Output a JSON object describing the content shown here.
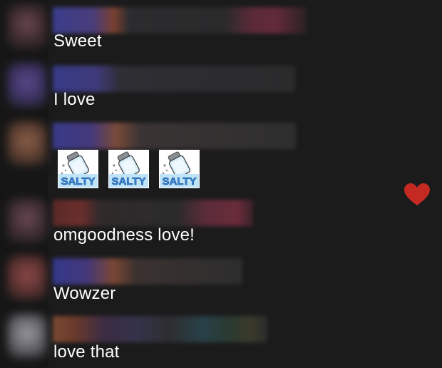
{
  "colors": {
    "background": "#1b1b1c",
    "avatar_column": "#161616",
    "text": "#ffffff",
    "heart": "#c42a22",
    "sticker_blue": "#3a8de0",
    "sticker_label_bg": "#bfe3f7"
  },
  "messages": [
    {
      "text": "Sweet"
    },
    {
      "text": "I love"
    },
    {
      "stickers": [
        {
          "label": "SALTY",
          "icon": "salt-shaker-icon"
        },
        {
          "label": "SALTY",
          "icon": "salt-shaker-icon"
        },
        {
          "label": "SALTY",
          "icon": "salt-shaker-icon"
        }
      ]
    },
    {
      "text": "omgoodness love!"
    },
    {
      "text": "Wowzer"
    },
    {
      "text": "love that"
    }
  ],
  "reaction": {
    "icon": "heart-icon"
  }
}
